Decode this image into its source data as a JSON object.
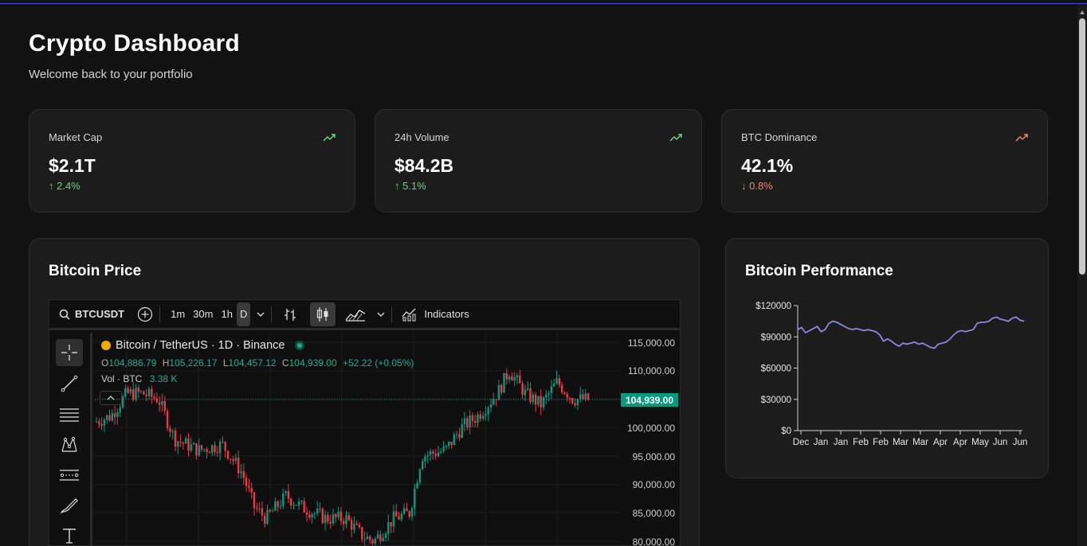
{
  "header": {
    "title": "Crypto Dashboard",
    "subtitle": "Welcome back to your portfolio"
  },
  "stats": [
    {
      "label": "Market Cap",
      "value": "$2.1T",
      "change": "↑ 2.4%",
      "direction": "up",
      "color": "#6fcf87"
    },
    {
      "label": "24h Volume",
      "value": "$84.2B",
      "change": "↑ 5.1%",
      "direction": "up",
      "color": "#6fcf87"
    },
    {
      "label": "BTC Dominance",
      "value": "42.1%",
      "change": "↓ 0.8%",
      "direction": "down",
      "color": "#e8866a"
    }
  ],
  "price_section": {
    "title": "Bitcoin Price",
    "toolbar": {
      "symbol": "BTCUSDT",
      "intervals": [
        "1m",
        "30m",
        "1h",
        "D"
      ],
      "active_interval": "D",
      "indicators_label": "Indicators"
    },
    "tools": [
      "crosshair-icon",
      "trendline-icon",
      "fib-retracement-icon",
      "pattern-icon",
      "prediction-icon",
      "brush-icon",
      "text-icon"
    ],
    "legend": {
      "symbol_name": "Bitcoin / TetherUS · 1D · Binance",
      "o_label": "O",
      "o": "104,886.79",
      "h_label": "H",
      "h": "105,226.17",
      "l_label": "L",
      "l": "104,457.12",
      "c_label": "C",
      "c": "104,939.00",
      "change": "+52.22 (+0.05%)",
      "vol_label": "Vol · BTC",
      "vol": "3.38 K"
    },
    "price_axis": [
      "115,000.00",
      "110,000.00",
      "100,000.00",
      "95,000.00",
      "90,000.00",
      "85,000.00",
      "80,000.00"
    ],
    "last_price": "104,939.00",
    "colors": {
      "up": "#089981",
      "down": "#f23645"
    }
  },
  "performance": {
    "title": "Bitcoin Performance",
    "line_color": "#8b86e0"
  },
  "chart_data": {
    "type": "line",
    "title": "Bitcoin Performance",
    "xlabel": "",
    "ylabel": "",
    "ylim": [
      0,
      120000
    ],
    "yticks": [
      "$120000",
      "$90000",
      "$60000",
      "$30000",
      "$0"
    ],
    "x_tick_labels": [
      "Dec",
      "Jan",
      "Jan",
      "Feb",
      "Feb",
      "Mar",
      "Mar",
      "Apr",
      "Apr",
      "May",
      "Jun",
      "Jun"
    ],
    "series": [
      {
        "values": [
          97000,
          99000,
          94000,
          96000,
          98000,
          100000,
          95000,
          97000,
          103000,
          105000,
          104000,
          102000,
          100000,
          98000,
          97000,
          98000,
          97000,
          96000,
          97000,
          96000,
          95000,
          92000,
          86000,
          88000,
          86000,
          83000,
          81000,
          84000,
          83000,
          84000,
          85000,
          83000,
          84000,
          82000,
          80000,
          79000,
          83000,
          84000,
          85000,
          88000,
          92000,
          95000,
          96000,
          95000,
          96000,
          97000,
          103000,
          104000,
          104000,
          105000,
          108000,
          109000,
          107000,
          106000,
          105000,
          108000,
          109000,
          106000,
          105000
        ]
      }
    ]
  }
}
